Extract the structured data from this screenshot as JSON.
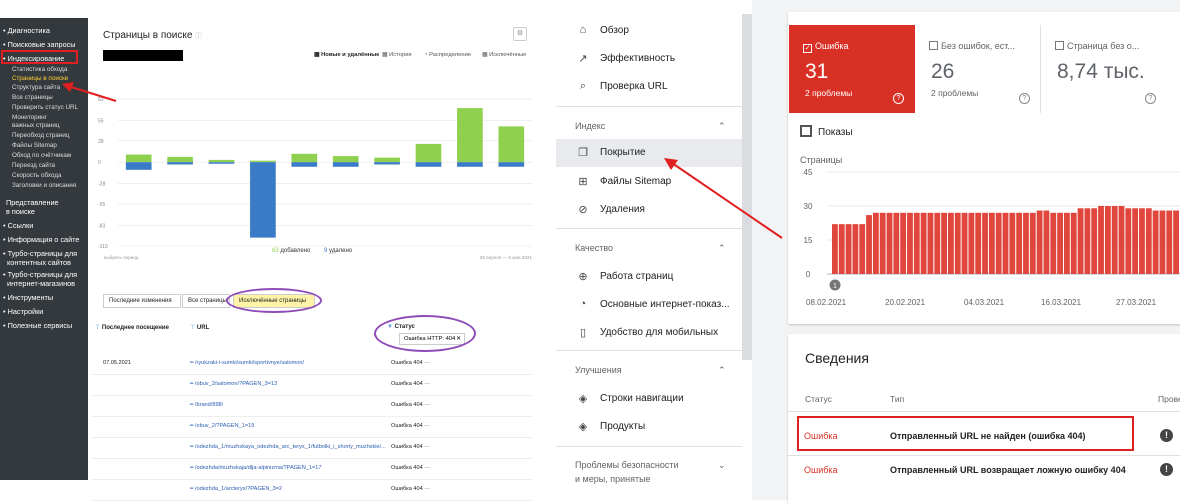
{
  "yandex": {
    "sidebar": {
      "sections": [
        {
          "label": "Диагностика",
          "top": 0
        },
        {
          "label": "Поисковые запросы"
        },
        {
          "label": "Индексирование"
        }
      ],
      "index_items": [
        "Статистика обхода",
        "Страницы в поиске",
        "Структура сайта",
        "Все страницы",
        "Проверить статус URL",
        "Мониторинг",
        "важных страниц",
        "Переобход страниц",
        "Файлы Sitemap",
        "Обход по счётчикам",
        "Переезд сайта",
        "Скорость обхода",
        "Заголовки и описания"
      ],
      "representation": [
        "Представление",
        "в поиске"
      ],
      "bottom_sections": [
        "Ссылки",
        "Информация о сайте",
        "Турбо-страницы для",
        "контентных сайтов",
        "Турбо-страницы для",
        "интернет-магазинов",
        "Инструменты",
        "Настройки",
        "Полезные сервисы"
      ]
    },
    "title": "Страницы в поиске",
    "title_info": "ⓘ",
    "tabs": [
      "Новые и удалённые",
      "История",
      "Распределение",
      "Исключённые"
    ],
    "chart_data": {
      "type": "bar",
      "yticks": [
        "83",
        "55",
        "28",
        "0",
        "-28",
        "-55",
        "-83",
        "-110"
      ],
      "ylim": [
        -110,
        100
      ],
      "x_start_label": "выбрать период",
      "x_end_label": "29 апреля — 5 мая 2021",
      "series": [
        {
          "name": "добавлено",
          "values": [
            10,
            7,
            3,
            2,
            11,
            8,
            6,
            24,
            71,
            47
          ]
        },
        {
          "name": "удалено",
          "values": [
            -10,
            -3,
            -2,
            -99,
            -6,
            -6,
            -3,
            -6,
            -6,
            -6
          ]
        }
      ]
    },
    "legend": {
      "added_count": "63",
      "added_label": "добавлено",
      "removed_count": "9",
      "removed_label": "удалено"
    },
    "page_tabs": [
      "Последние изменения",
      "Все страницы",
      "Исключённые страницы"
    ],
    "columns": {
      "last_visit": "Последнее посещение",
      "url": "URL",
      "status": "Статус"
    },
    "status_filter": "Ошибка HTTP: 404",
    "rows": [
      {
        "date": "07.05.2021",
        "url": "/ryukzaki-i-sumki/sumki/sportivnye/salomon/",
        "status": "Ошибка 404"
      },
      {
        "date": "",
        "url": "/obuv_2/salomon/?PAGEN_3=13",
        "status": "Ошибка 404"
      },
      {
        "date": "",
        "url": "/brand/898/",
        "status": "Ошибка 404"
      },
      {
        "date": "",
        "url": "/obuv_2/?PAGEN_1=19",
        "status": "Ошибка 404"
      },
      {
        "date": "",
        "url": "/odezhda_1/muzhskaya_odezhda_arc_teryx_1/futbolki_i_shorty_muzhskie/...",
        "status": "Ошибка 404"
      },
      {
        "date": "",
        "url": "/odezhda/muzhskaja/dlja-alpinizma/?PAGEN_1=17",
        "status": "Ошибка 404"
      },
      {
        "date": "",
        "url": "/odezhda_1/arcteryx/?PAGEN_3=2",
        "status": "Ошибка 404"
      }
    ]
  },
  "google": {
    "nav_top": [
      {
        "label": "Обзор",
        "icon": "home-icon"
      },
      {
        "label": "Эффективность",
        "icon": "trend-icon"
      },
      {
        "label": "Проверка URL",
        "icon": "search-icon"
      }
    ],
    "section_index": "Индекс",
    "nav_index": [
      {
        "label": "Покрытие",
        "icon": "file-icon"
      },
      {
        "label": "Файлы Sitemap",
        "icon": "sitemap-icon"
      },
      {
        "label": "Удаления",
        "icon": "eye-off-icon"
      }
    ],
    "section_quality": "Качество",
    "nav_quality": [
      {
        "label": "Работа страниц",
        "icon": "plus-circle-icon"
      },
      {
        "label": "Основные интернет-показ...",
        "icon": "gauge-icon"
      },
      {
        "label": "Удобство для мобильных",
        "icon": "phone-icon"
      }
    ],
    "section_improvements": "Улучшения",
    "nav_improvements": [
      {
        "label": "Строки навигации",
        "icon": "layers-icon"
      },
      {
        "label": "Продукты",
        "icon": "layers-icon"
      }
    ],
    "section_security": [
      "Проблемы безопасности",
      "и меры, принятые"
    ],
    "stats": [
      {
        "label": "Ошибка",
        "value": "31",
        "sub": "2 проблемы"
      },
      {
        "label": "Без ошибок, ест...",
        "value": "26",
        "sub": "2 проблемы"
      },
      {
        "label": "Страница без о...",
        "value": "8,74 тыс.",
        "sub": ""
      }
    ],
    "impressions_label": "Показы",
    "chart_data": {
      "type": "bar",
      "ylabel": "Страницы",
      "yticks": [
        "45",
        "30",
        "15",
        "0"
      ],
      "ylim": [
        0,
        45
      ],
      "xticks": [
        "08.02.2021",
        "20.02.2021",
        "04.03.2021",
        "16.03.2021",
        "27.03.2021"
      ],
      "values": [
        22,
        22,
        22,
        22,
        22,
        26,
        27,
        27,
        27,
        27,
        27,
        27,
        27,
        27,
        27,
        27,
        27,
        27,
        27,
        27,
        27,
        27,
        27,
        27,
        27,
        27,
        27,
        27,
        27,
        27,
        28,
        28,
        27,
        27,
        27,
        27,
        29,
        29,
        29,
        30,
        30,
        30,
        30,
        29,
        29,
        29,
        29,
        28,
        28,
        28,
        28
      ],
      "annotation": "1"
    },
    "details_title": "Сведения",
    "table_cols": {
      "status": "Статус",
      "type": "Тип",
      "check": "Прове"
    },
    "table_rows": [
      {
        "status": "Ошибка",
        "type": "Отправленный URL не найден (ошибка 404)"
      },
      {
        "status": "Ошибка",
        "type": "Отправленный URL возвращает ложную ошибку 404"
      }
    ]
  },
  "colors": {
    "added": "#8fd14f",
    "removed": "#3a7bc8",
    "error": "#d93025",
    "gbar": "#e0463c",
    "highlight": "#e02020",
    "purple": "#8f4bb8"
  }
}
